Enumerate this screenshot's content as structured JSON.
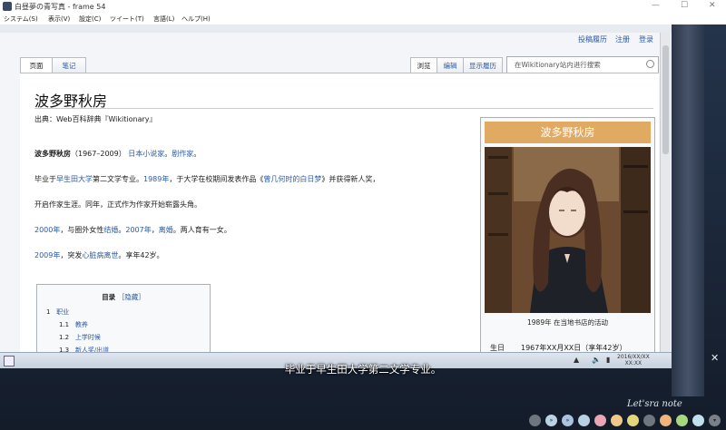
{
  "window": {
    "title": "白昼夢の青写真 - frame 54"
  },
  "menubar": {
    "items": [
      "システム(S)",
      "表示(V)",
      "設定(C)",
      "ツイート(T)",
      "言語(L)",
      "ヘルプ(H)"
    ]
  },
  "wiki": {
    "toplinks": [
      "投稿履历",
      "注册",
      "登录"
    ],
    "tabs_left": [
      "页面",
      "笔记"
    ],
    "tabs_right": [
      "浏览",
      "编辑",
      "显示履历"
    ],
    "search_placeholder": "在Wikitionary站内进行搜索",
    "page_title": "波多野秋房",
    "source": "出典：Web百科辞典『Wikitionary』",
    "lead": {
      "name": "波多野秋房",
      "years": "（1967–2009）",
      "link1": "日本小说家",
      "sep": "。",
      "link2": "剧作家",
      "end": "。"
    },
    "p1": {
      "a": "毕业于",
      "l1": "早生田大学",
      "b": "第二文学专业。",
      "l2": "1989年",
      "c": "，于大学在校期间发表作品《",
      "l3": "曾几何时的白日梦",
      "d": "》并获得新人奖，"
    },
    "p1b": "开启作家生涯。同年，正式作为作家开始崭露头角。",
    "p2": {
      "l1": "2000年",
      "a": "，与圈外女性",
      "l2": "结婚",
      "b": "。",
      "l3": "2007年",
      "c": "，",
      "l4": "离婚",
      "d": "。两人育有一女。"
    },
    "p3": {
      "l1": "2009年",
      "a": "，突发",
      "l2": "心脏病离世",
      "b": "。享年42岁。"
    },
    "toc": {
      "label": "目录",
      "toggle": "［隐藏］",
      "items": [
        {
          "num": "1",
          "text": "职业"
        },
        {
          "num": "1.1",
          "text": "教养"
        },
        {
          "num": "1.2",
          "text": "上学时候"
        },
        {
          "num": "1.3",
          "text": "新人奖/出道"
        }
      ]
    },
    "infobox": {
      "title": "波多野秋房",
      "caption": "1989年 在当地书店的活动",
      "birth_label": "生日",
      "birth_value": "1967年XX月XX日（享年42岁）"
    }
  },
  "taskbar": {
    "clock_date": "2016/XX/XX",
    "clock_time": "XX:XX"
  },
  "dialogue": "毕业于早生田大学第二文学专业。",
  "brand": "Let'sra note",
  "colors": {
    "link": "#2b5aa8",
    "infobox_title": "#e1aa63"
  }
}
